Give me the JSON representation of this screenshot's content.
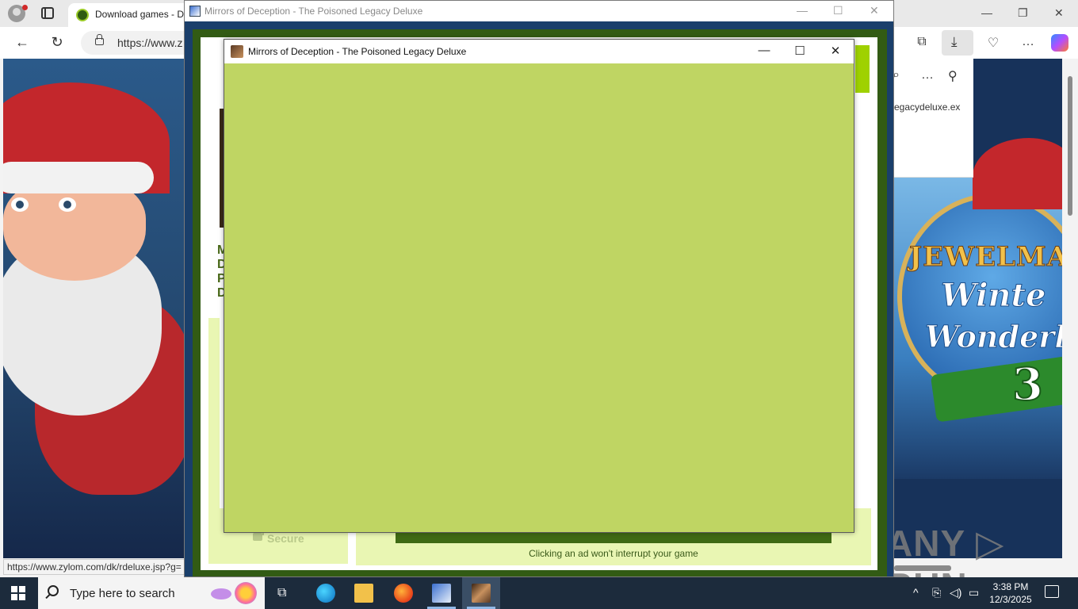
{
  "browser": {
    "tab_title": "Download games - D",
    "address": "https://www.z",
    "status_url": "https://www.zylom.com/dk/rdeluxe.jsp?g=",
    "download_name": "egacydeluxe.ex"
  },
  "launcher": {
    "title": "Mirrors of Deception - The Poisoned Legacy Deluxe",
    "game_title_partial": "MDPD",
    "secure_label": "Secure",
    "ad_note": "Clicking an ad won't interrupt your game"
  },
  "game_window": {
    "title": "Mirrors of Deception - The Poisoned Legacy Deluxe",
    "canvas_color": "#bfd563"
  },
  "ads": {
    "jewel_title": "JEWELMA",
    "jewel_sub1": "Winte",
    "jewel_sub2": "Wonderl",
    "jewel_num": "3"
  },
  "watermark": "ANY ▷ RUN",
  "taskbar": {
    "search_placeholder": "Type here to search",
    "time": "3:38 PM",
    "date": "12/3/2025"
  },
  "icons": {
    "back": "←",
    "reload": "↻",
    "minimize": "—",
    "restore": "❐",
    "close": "✕",
    "more": "…",
    "pin": "⚲",
    "search": "⌕",
    "download": "⤓"
  }
}
